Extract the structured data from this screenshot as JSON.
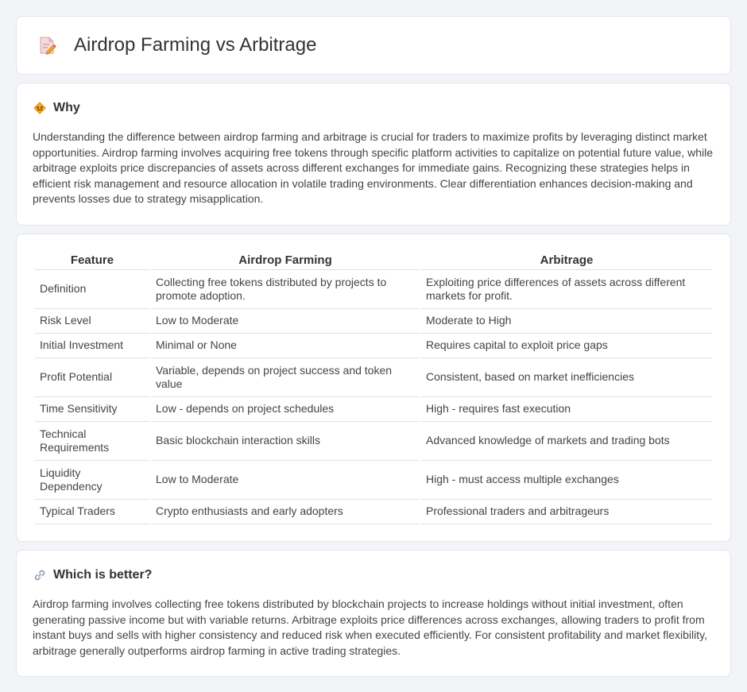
{
  "header": {
    "title": "Airdrop Farming vs Arbitrage",
    "icon": "document-pencil-icon"
  },
  "why": {
    "title": "Why",
    "icon": "diamond-sign-icon",
    "text": "Understanding the difference between airdrop farming and arbitrage is crucial for traders to maximize profits by leveraging distinct market opportunities. Airdrop farming involves acquiring free tokens through specific platform activities to capitalize on potential future value, while arbitrage exploits price discrepancies of assets across different exchanges for immediate gains. Recognizing these strategies helps in efficient risk management and resource allocation in volatile trading environments. Clear differentiation enhances decision-making and prevents losses due to strategy misapplication."
  },
  "table": {
    "headers": [
      "Feature",
      "Airdrop Farming",
      "Arbitrage"
    ],
    "rows": [
      [
        "Definition",
        "Collecting free tokens distributed by projects to promote adoption.",
        "Exploiting price differences of assets across different markets for profit."
      ],
      [
        "Risk Level",
        "Low to Moderate",
        "Moderate to High"
      ],
      [
        "Initial Investment",
        "Minimal or None",
        "Requires capital to exploit price gaps"
      ],
      [
        "Profit Potential",
        "Variable, depends on project success and token value",
        "Consistent, based on market inefficiencies"
      ],
      [
        "Time Sensitivity",
        "Low - depends on project schedules",
        "High - requires fast execution"
      ],
      [
        "Technical Requirements",
        "Basic blockchain interaction skills",
        "Advanced knowledge of markets and trading bots"
      ],
      [
        "Liquidity Dependency",
        "Low to Moderate",
        "High - must access multiple exchanges"
      ],
      [
        "Typical Traders",
        "Crypto enthusiasts and early adopters",
        "Professional traders and arbitrageurs"
      ]
    ]
  },
  "better": {
    "title": "Which is better?",
    "icon": "link-icon",
    "text": "Airdrop farming involves collecting free tokens distributed by blockchain projects to increase holdings without initial investment, often generating passive income but with variable returns. Arbitrage exploits price differences across exchanges, allowing traders to profit from instant buys and sells with higher consistency and reduced risk when executed efficiently. For consistent profitability and market flexibility, arbitrage generally outperforms airdrop farming in active trading strategies."
  },
  "colors": {
    "background": "#f2f4f7",
    "card": "#ffffff",
    "border": "#e1e5ea",
    "accent_orange": "#f5a623"
  }
}
